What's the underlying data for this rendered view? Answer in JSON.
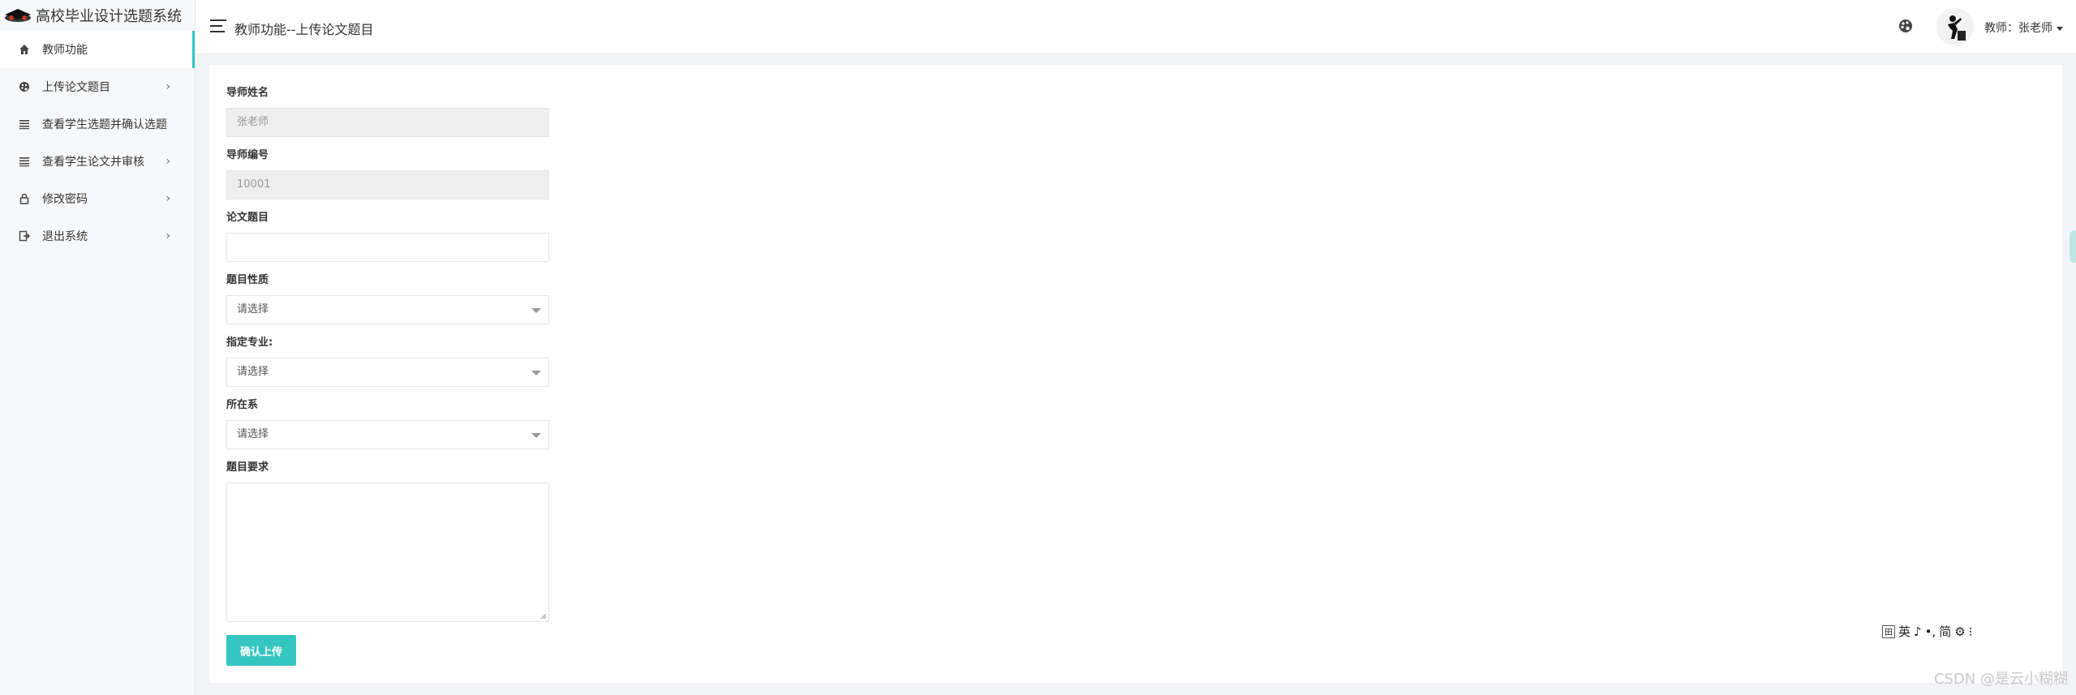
{
  "app": {
    "title": "高校毕业设计选题系统"
  },
  "sidebar": {
    "items": [
      {
        "label": "教师功能",
        "icon": "home-icon",
        "active": true,
        "chevron": ""
      },
      {
        "label": "上传论文题目",
        "icon": "palette-icon",
        "chevron": "›"
      },
      {
        "label": "查看学生选题并确认选题",
        "icon": "list-icon",
        "chevron": ""
      },
      {
        "label": "查看学生论文并审核",
        "icon": "list-icon",
        "chevron": "›"
      },
      {
        "label": "修改密码",
        "icon": "lock-icon",
        "chevron": "›"
      },
      {
        "label": "退出系统",
        "icon": "logout-icon",
        "chevron": "›"
      }
    ]
  },
  "header": {
    "title": "教师功能--上传论文题目",
    "user_label": "教师：张老师"
  },
  "form": {
    "advisor_name": {
      "label": "导师姓名",
      "value": "张老师"
    },
    "advisor_id": {
      "label": "导师编号",
      "value": "10001"
    },
    "thesis_title": {
      "label": "论文题目",
      "value": ""
    },
    "topic_type": {
      "label": "题目性质",
      "value": "请选择"
    },
    "major": {
      "label": "指定专业:",
      "value": "请选择"
    },
    "department": {
      "label": "所在系",
      "value": "请选择"
    },
    "requirements": {
      "label": "题目要求",
      "value": ""
    },
    "submit_label": "确认上传"
  },
  "ime": {
    "chars": [
      "英",
      "♪",
      "•,",
      "简",
      "⚙",
      "⁝"
    ]
  },
  "watermark": "CSDN @是云小糊糊",
  "colors": {
    "accent": "#36c6c1"
  }
}
